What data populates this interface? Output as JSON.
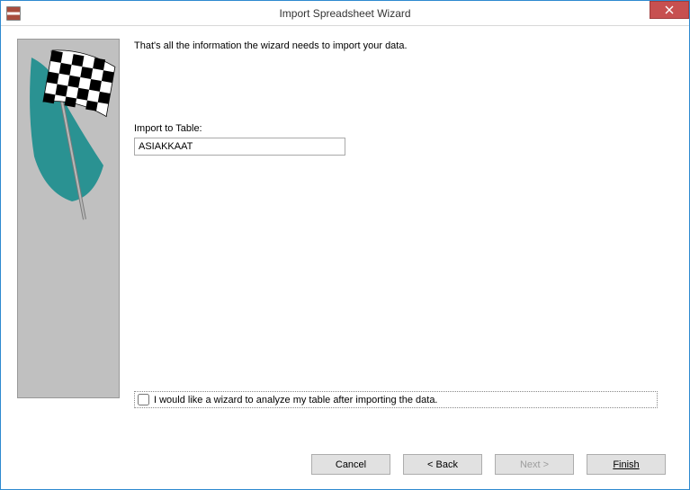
{
  "window": {
    "title": "Import Spreadsheet Wizard"
  },
  "main": {
    "intro": "That's all the information the wizard needs to import your data.",
    "import_label": "Import to Table:",
    "import_value": "ASIAKKAAT",
    "analyze_label": "I would like a wizard to analyze my table after importing the data."
  },
  "buttons": {
    "cancel": "Cancel",
    "back": "< Back",
    "next": "Next >",
    "finish": "Finish"
  }
}
